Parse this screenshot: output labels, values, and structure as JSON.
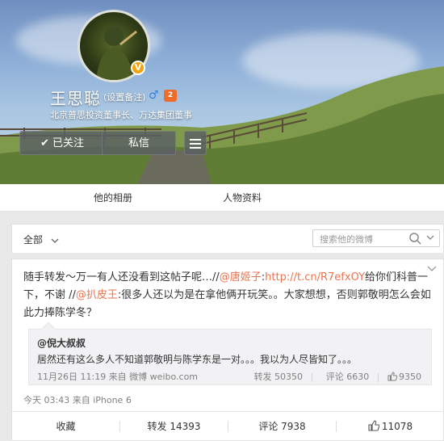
{
  "profile": {
    "name": "王思聪",
    "remark_label": "(设置备注)",
    "title": "北京普思投资董事长、万达集团董事",
    "verified_badge": "V",
    "level_badge": "2",
    "gender_icon": "male-icon",
    "follow_label": "✔ 已关注",
    "message_label": "私信",
    "more_icon": "menu-icon"
  },
  "tabs": [
    "他的相册",
    "人物资料"
  ],
  "filter": {
    "label": "全部",
    "search_placeholder": "搜索他的微博"
  },
  "post": {
    "text_before": "随手转发～万一有人还没看到这帖子呢…//",
    "mention1": "@唐姬子",
    "link": "http://t.cn/R7efxOY",
    "text_mid": "给你们科普一下，不谢 //",
    "mention2": "@扒皮王",
    "text_after": ":很多人还以为是在拿他俩开玩笑。。大家想想，否则郭敬明怎么会如此力捧陈学冬？",
    "meta": "今天 03:43 来自 iPhone 6",
    "actions": {
      "favorite": "收藏",
      "repost": "转发 14393",
      "comment": "评论 7938",
      "like": "11078"
    }
  },
  "quote": {
    "author": "@倪大叔叔",
    "text": "居然还有这么多人不知道郭敬明与陈学东是一对。。。我以为人尽皆知了。。。",
    "meta_time": "11月26日 11:19 来自 微博 weibo.com",
    "repost": "转发 50350",
    "comment": "评论 6630",
    "like": "9350"
  },
  "colors": {
    "accent": "#eb7350",
    "gender": "#3a7fd6",
    "verified": "#f2a20a"
  }
}
